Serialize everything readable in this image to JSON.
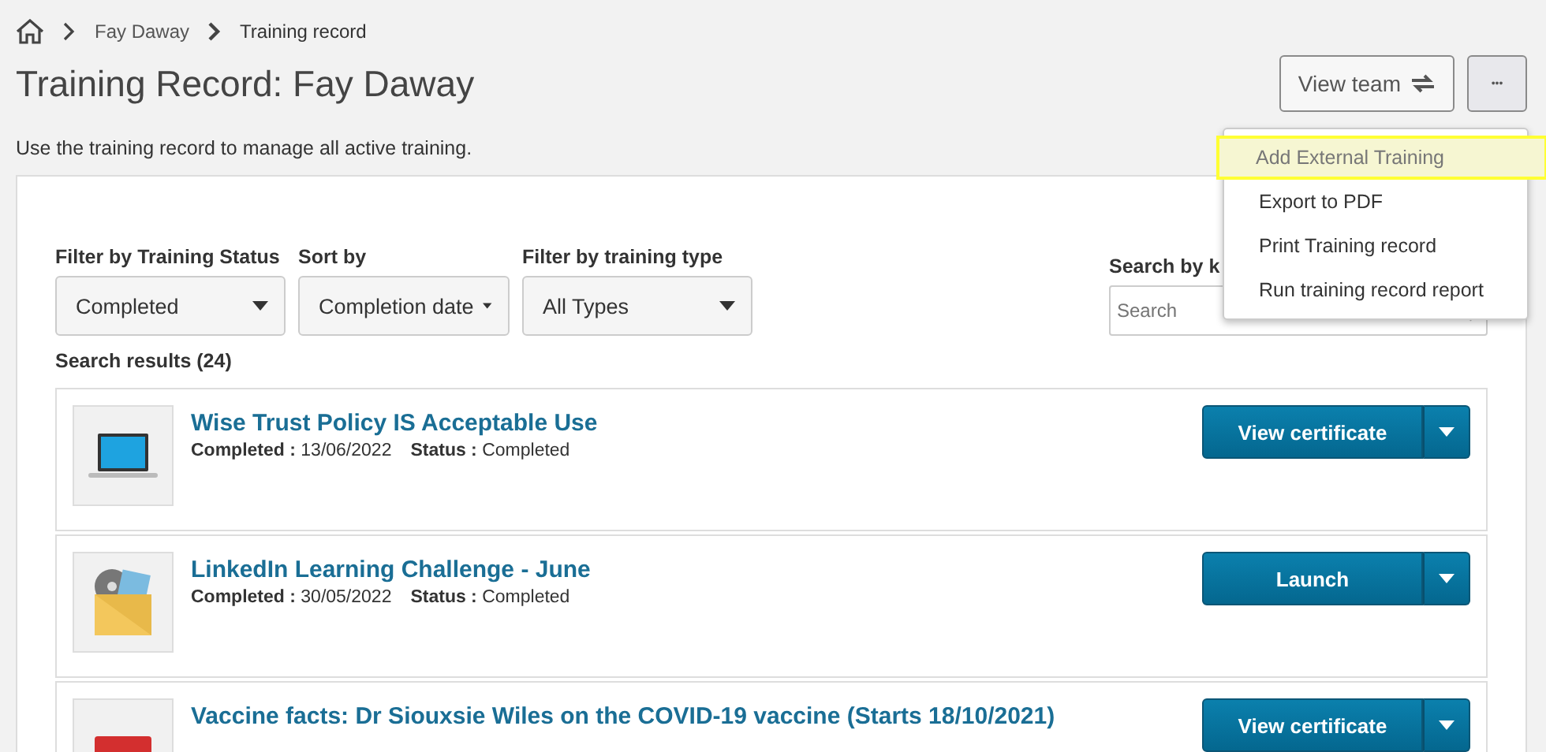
{
  "breadcrumb": [
    {
      "kind": "home"
    },
    {
      "kind": "link",
      "label": "Fay Daway"
    },
    {
      "kind": "current",
      "label": "Training record"
    }
  ],
  "title": "Training Record: Fay Daway",
  "subtitle": "Use the training record to manage all active training.",
  "header_buttons": [
    {
      "kind": "text",
      "label": "View team"
    },
    {
      "kind": "more",
      "label": "•••"
    }
  ],
  "menu": {
    "items": [
      {
        "label": "Add External Training",
        "highlighted": true
      },
      {
        "label": "Export to PDF",
        "highlighted": false
      },
      {
        "label": "Print Training record",
        "highlighted": false
      },
      {
        "label": "Run training record report",
        "highlighted": false
      }
    ]
  },
  "filters": [
    {
      "label": "Filter by Training Status",
      "value": "Completed"
    },
    {
      "label": "Sort by",
      "value": "Completion date"
    },
    {
      "label": "Filter by training type",
      "value": "All Types"
    }
  ],
  "search": {
    "label": "Search by k",
    "placeholder": "Search"
  },
  "results_count": "Search results (24)",
  "results": [
    {
      "kind": "laptop",
      "title": "Wise Trust Policy IS Acceptable Use",
      "completed_label": "Completed :",
      "completed": "13/06/2022",
      "status_label": "Status :",
      "status": "Completed",
      "action": "View certificate"
    },
    {
      "kind": "folder",
      "title": "LinkedIn Learning Challenge - June",
      "completed_label": "Completed :",
      "completed": "30/05/2022",
      "status_label": "Status :",
      "status": "Completed",
      "action": "Launch"
    },
    {
      "kind": "calendar",
      "title": "Vaccine facts: Dr Siouxsie Wiles on the COVID-19 vaccine (Starts 18/10/2021)",
      "action": "View certificate"
    }
  ]
}
